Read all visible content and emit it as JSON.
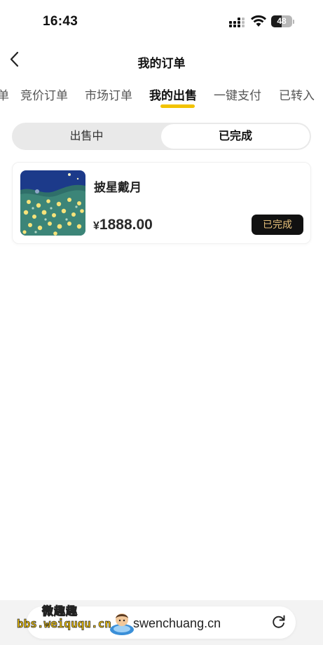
{
  "status_bar": {
    "time": "16:43",
    "battery": "48"
  },
  "header": {
    "title": "我的订单"
  },
  "tabs": [
    {
      "label": "单"
    },
    {
      "label": "竞价订单"
    },
    {
      "label": "市场订单"
    },
    {
      "label": "我的出售",
      "active": true
    },
    {
      "label": "一键支付"
    },
    {
      "label": "已转入"
    }
  ],
  "segment": {
    "left": "出售中",
    "right": "已完成",
    "selected": "已完成"
  },
  "orders": [
    {
      "name": "披星戴月",
      "currency": "¥",
      "price": "1888.00",
      "status": "已完成"
    }
  ],
  "browser": {
    "url": "swenchuang.cn"
  },
  "watermark": {
    "logo": "微趣趣",
    "url": "bbs.weiququ.cn"
  },
  "colors": {
    "accent": "#f2c300",
    "badge_bg": "#111111",
    "badge_text": "#e6c07a",
    "segment_bg": "#e9e9e9"
  }
}
